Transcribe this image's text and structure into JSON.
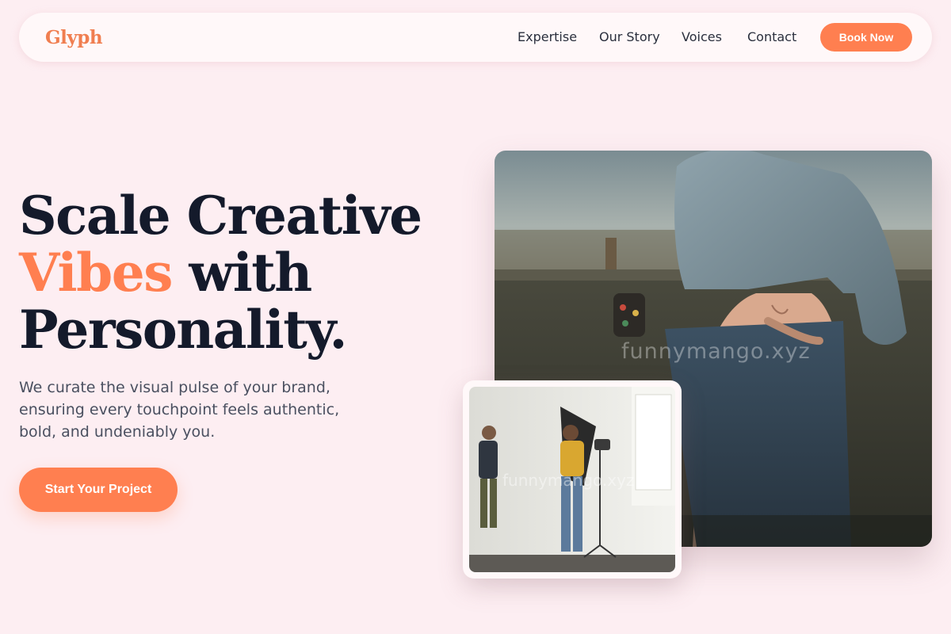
{
  "brand": {
    "logo": "Glyph",
    "accent_color": "#ff7f50"
  },
  "nav": {
    "links": [
      "Expertise",
      "Our Story",
      "Voices",
      "Contact"
    ],
    "cta": "Book Now"
  },
  "hero": {
    "title_line1": "Scale Creative",
    "title_accent": "Vibes",
    "title_line2_rest": " with",
    "title_line3": "Personality.",
    "subtitle": "We curate the visual pulse of your brand, ensuring every touchpoint feels authentic, bold, and undeniably you.",
    "cta": "Start Your Project"
  },
  "images": {
    "main_photo": {
      "icon": "denim-jacket-photo",
      "watermark": "funnymango.xyz"
    },
    "small_photo": {
      "icon": "photo-studio-photo",
      "watermark": "funnymango.xyz"
    }
  }
}
